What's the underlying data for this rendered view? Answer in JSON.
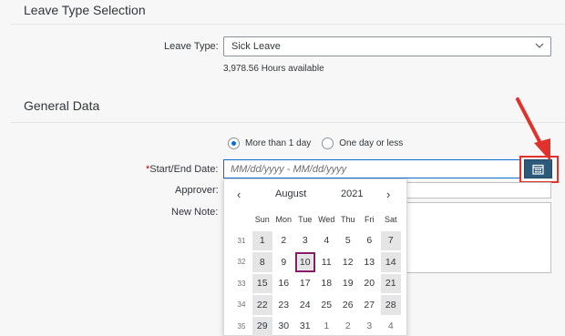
{
  "leave_section": {
    "title": "Leave Type Selection",
    "leave_type_label": "Leave Type:",
    "leave_type_value": "Sick Leave",
    "hours_available": "3,978.56 Hours available"
  },
  "general_section": {
    "title": "General Data",
    "radio_more": "More than 1 day",
    "radio_one": "One day or less",
    "selected_option": "More than 1 day",
    "start_end_required": "*",
    "start_end_label": "Start/End Date:",
    "date_placeholder": "MM/dd/yyyy - MM/dd/yyyy",
    "approver_label": "Approver:",
    "new_note_label": "New Note:"
  },
  "calendar": {
    "prev": "‹",
    "next": "›",
    "month": "August",
    "year": "2021",
    "day_names": [
      "Sun",
      "Mon",
      "Tue",
      "Wed",
      "Thu",
      "Fri",
      "Sat"
    ],
    "weeks": [
      {
        "num": "31",
        "days": [
          "1",
          "2",
          "3",
          "4",
          "5",
          "6",
          "7"
        ]
      },
      {
        "num": "32",
        "days": [
          "8",
          "9",
          "10",
          "11",
          "12",
          "13",
          "14"
        ]
      },
      {
        "num": "33",
        "days": [
          "15",
          "16",
          "17",
          "18",
          "19",
          "20",
          "21"
        ]
      },
      {
        "num": "34",
        "days": [
          "22",
          "23",
          "24",
          "25",
          "26",
          "27",
          "28"
        ]
      },
      {
        "num": "35",
        "days": [
          "29",
          "30",
          "31",
          "1",
          "2",
          "3",
          "4"
        ]
      }
    ],
    "today": "10"
  },
  "colors": {
    "accent": "#0a6ed1",
    "calendar_button": "#2d5a7a",
    "highlight": "#e0312b",
    "today_border": "#8b1a6b"
  },
  "icons": {
    "dropdown": "chevron-down-icon",
    "calendar": "calendar-icon",
    "annotation": "red-arrow"
  }
}
